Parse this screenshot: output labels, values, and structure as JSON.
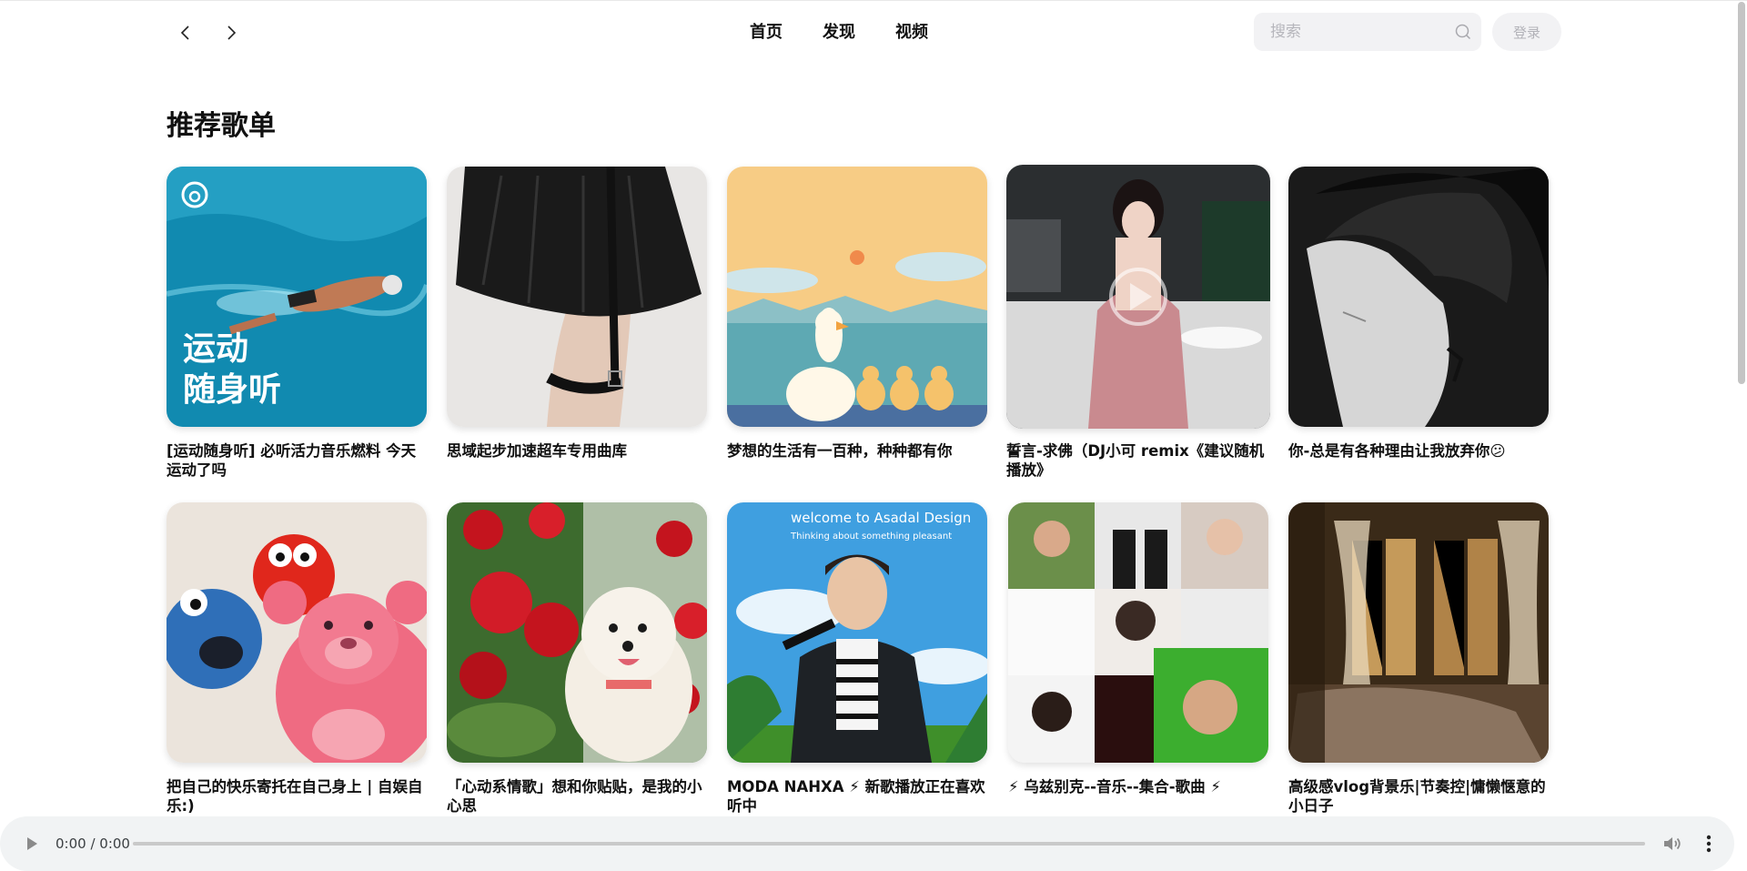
{
  "header": {
    "back_icon": "chevron-left-icon",
    "forward_icon": "chevron-right-icon",
    "nav": [
      "首页",
      "发现",
      "视频"
    ],
    "search_placeholder": "搜索",
    "login_label": "登录"
  },
  "section": {
    "title": "推荐歌单"
  },
  "playlists": [
    {
      "title": "[运动随身听] 必听活力音乐燃料 今天运动了吗",
      "cover_text": [
        "运动",
        "随身听"
      ]
    },
    {
      "title": "思域起步加速超车专用曲库"
    },
    {
      "title": "梦想的生活有一百种，种种都有你"
    },
    {
      "title": "誓言-求佛（DJ小可 remix《建议随机播放》"
    },
    {
      "title": "你-总是有各种理由让我放弃你😕"
    },
    {
      "title": "把自己的快乐寄托在自己身上 | 自娱自乐:)"
    },
    {
      "title": "「心动系情歌」想和你贴贴，是我的小心思"
    },
    {
      "title": "MODA NAHXA ⚡ 新歌播放正在喜欢听中",
      "cover_text": [
        "welcome to Asadal Design",
        "Thinking about something pleasant"
      ]
    },
    {
      "title": "⚡ 乌兹别克--音乐--集合-歌曲 ⚡"
    },
    {
      "title": "高级感vlog背景乐|节奏控|慵懒惬意的小日子"
    }
  ],
  "player": {
    "time": "0:00 / 0:00",
    "progress": 0
  }
}
